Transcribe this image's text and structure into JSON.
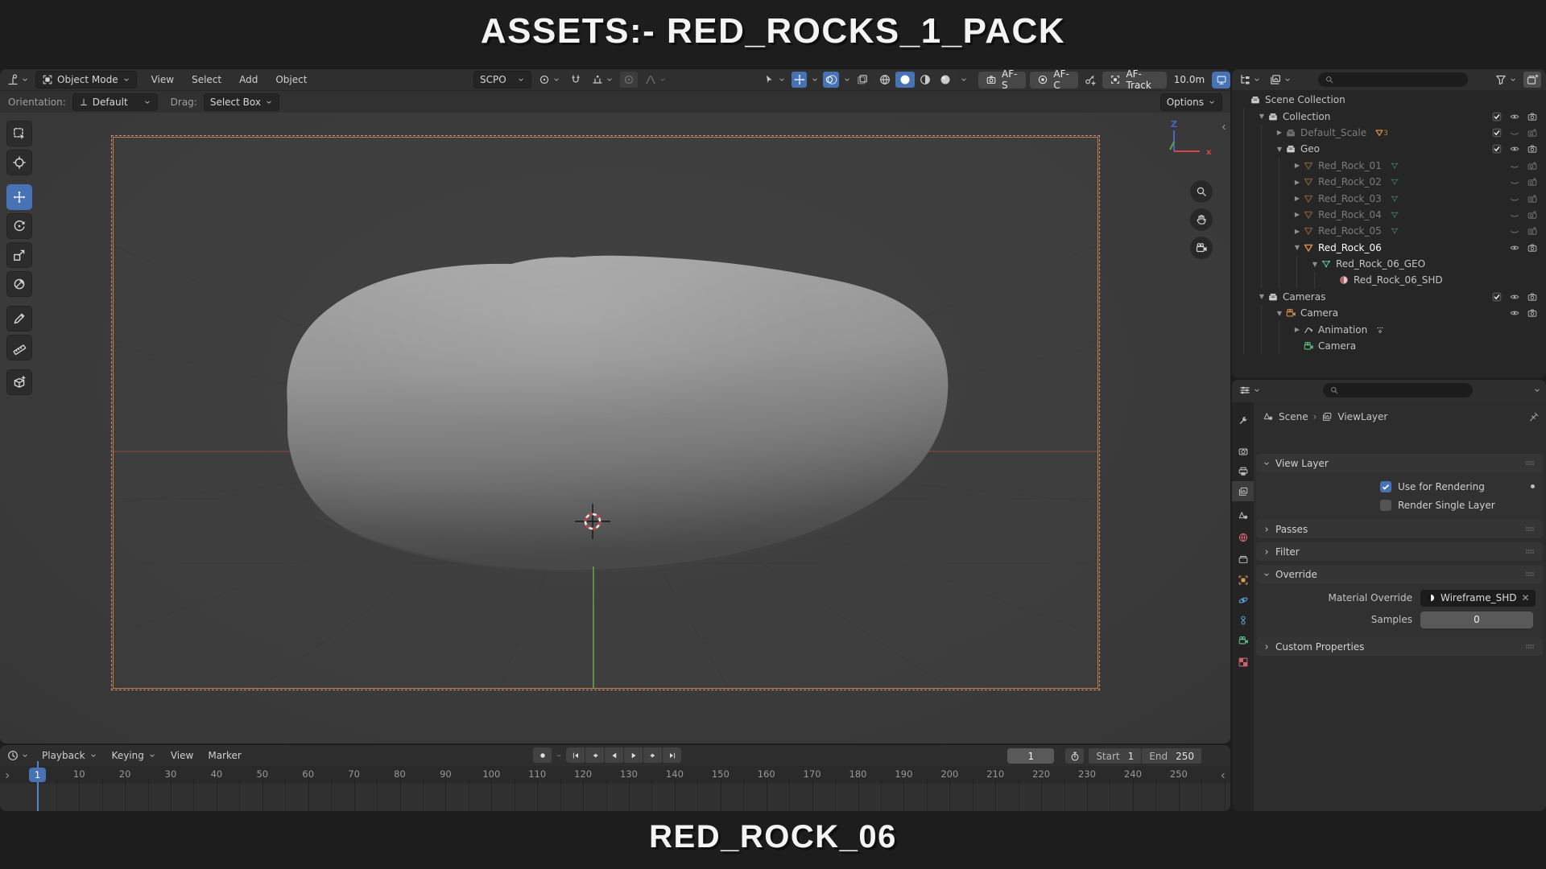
{
  "page": {
    "top_title": "ASSETS:- RED_ROCKS_1_PACK",
    "bottom_title": "RED_ROCK_06"
  },
  "colors": {
    "accent_blue": "#4772b3",
    "object_orange": "#d68d49",
    "mesh_green": "#55c07f",
    "camera_border_dash": "#e07f7f",
    "camera_border_solid": "#cd9646"
  },
  "viewport": {
    "header": {
      "mode": "Object Mode",
      "menus": [
        "View",
        "Select",
        "Add",
        "Object"
      ],
      "orientation": "SCPO",
      "af_s": "AF-S",
      "af_c": "AF-C",
      "af_track": "AF-Track",
      "focus_distance": "10.0m"
    },
    "tool_settings": {
      "orientation_label": "Orientation:",
      "orientation_value": "Default",
      "drag_label": "Drag:",
      "drag_value": "Select Box",
      "options_label": "Options"
    },
    "tools": [
      {
        "name": "select-box"
      },
      {
        "name": "cursor"
      },
      {
        "name": "move",
        "active": true
      },
      {
        "name": "rotate"
      },
      {
        "name": "scale"
      },
      {
        "name": "transform"
      },
      {
        "name": "annotate"
      },
      {
        "name": "measure"
      },
      {
        "name": "add-cube"
      }
    ]
  },
  "outliner": {
    "rows": [
      {
        "label": "Scene Collection",
        "level": 0,
        "icon": "collection",
        "toggles": []
      },
      {
        "label": "Collection",
        "level": 1,
        "expand": "open",
        "icon": "collection",
        "toggles": [
          "check",
          "eye",
          "cam"
        ]
      },
      {
        "label": "Default_Scale",
        "level": 2,
        "expand": "closed",
        "icon": "collection",
        "dim": true,
        "badge": "tri3",
        "badge_count": "3",
        "toggles": [
          "check",
          "eye-off",
          "cam-off"
        ]
      },
      {
        "label": "Geo",
        "level": 2,
        "expand": "open",
        "icon": "collection",
        "toggles": [
          "check",
          "eye",
          "cam"
        ]
      },
      {
        "label": "Red_Rock_01",
        "level": 3,
        "expand": "closed",
        "icon": "mesh-obj",
        "dim": true,
        "badge": "meshdata",
        "toggles": [
          "eye-off",
          "cam-off"
        ]
      },
      {
        "label": "Red_Rock_02",
        "level": 3,
        "expand": "closed",
        "icon": "mesh-obj",
        "dim": true,
        "badge": "meshdata",
        "toggles": [
          "eye-off",
          "cam-off"
        ]
      },
      {
        "label": "Red_Rock_03",
        "level": 3,
        "expand": "closed",
        "icon": "mesh-obj",
        "dim": true,
        "badge": "meshdata",
        "toggles": [
          "eye-off",
          "cam-off"
        ]
      },
      {
        "label": "Red_Rock_04",
        "level": 3,
        "expand": "closed",
        "icon": "mesh-obj",
        "dim": true,
        "badge": "meshdata",
        "toggles": [
          "eye-off",
          "cam-off"
        ]
      },
      {
        "label": "Red_Rock_05",
        "level": 3,
        "expand": "closed",
        "icon": "mesh-obj",
        "dim": true,
        "badge": "meshdata",
        "toggles": [
          "eye-off",
          "cam-off"
        ]
      },
      {
        "label": "Red_Rock_06",
        "level": 3,
        "expand": "open",
        "icon": "mesh-obj",
        "active": true,
        "toggles": [
          "eye",
          "cam"
        ]
      },
      {
        "label": "Red_Rock_06_GEO",
        "level": 4,
        "expand": "open",
        "icon": "mesh-data",
        "toggles": []
      },
      {
        "label": "Red_Rock_06_SHD",
        "level": 5,
        "icon": "material",
        "toggles": []
      },
      {
        "label": "Cameras",
        "level": 1,
        "expand": "open",
        "icon": "collection",
        "toggles": [
          "check",
          "eye",
          "cam"
        ]
      },
      {
        "label": "Camera",
        "level": 2,
        "expand": "open",
        "icon": "cam-obj",
        "toggles": [
          "eye",
          "cam"
        ]
      },
      {
        "label": "Animation",
        "level": 3,
        "expand": "closed",
        "icon": "anim",
        "badge": "keys",
        "toggles": []
      },
      {
        "label": "Camera",
        "level": 3,
        "icon": "cam-data",
        "toggles": []
      }
    ]
  },
  "properties": {
    "breadcrumb": {
      "scene": "Scene",
      "viewlayer": "ViewLayer"
    },
    "tabs": [
      {
        "name": "tool"
      },
      {
        "name": "render"
      },
      {
        "name": "output"
      },
      {
        "name": "view-layer",
        "active": true
      },
      {
        "name": "scene"
      },
      {
        "name": "world"
      },
      {
        "name": "collection"
      },
      {
        "name": "object"
      },
      {
        "name": "physics"
      },
      {
        "name": "constraints"
      },
      {
        "name": "camera-data"
      },
      {
        "name": "texture"
      }
    ],
    "view_layer": {
      "title": "View Layer",
      "use_for_rendering": "Use for Rendering",
      "render_single_layer": "Render Single Layer"
    },
    "passes_title": "Passes",
    "filter_title": "Filter",
    "override": {
      "title": "Override",
      "material_label": "Material Override",
      "material_value": "Wireframe_SHD",
      "samples_label": "Samples",
      "samples_value": "0"
    },
    "custom_properties_title": "Custom Properties"
  },
  "timeline": {
    "menus": [
      {
        "label": "Playback",
        "chev": true
      },
      {
        "label": "Keying",
        "chev": true
      },
      {
        "label": "View"
      },
      {
        "label": "Marker"
      }
    ],
    "current_frame": "1",
    "frame_field_value": "1",
    "start_label": "Start",
    "start_value": "1",
    "end_label": "End",
    "end_value": "250",
    "ruler_labels": [
      10,
      20,
      30,
      40,
      50,
      60,
      70,
      80,
      90,
      100,
      110,
      120,
      130,
      140,
      150,
      160,
      170,
      180,
      190,
      200,
      210,
      220,
      230,
      240,
      250
    ]
  }
}
